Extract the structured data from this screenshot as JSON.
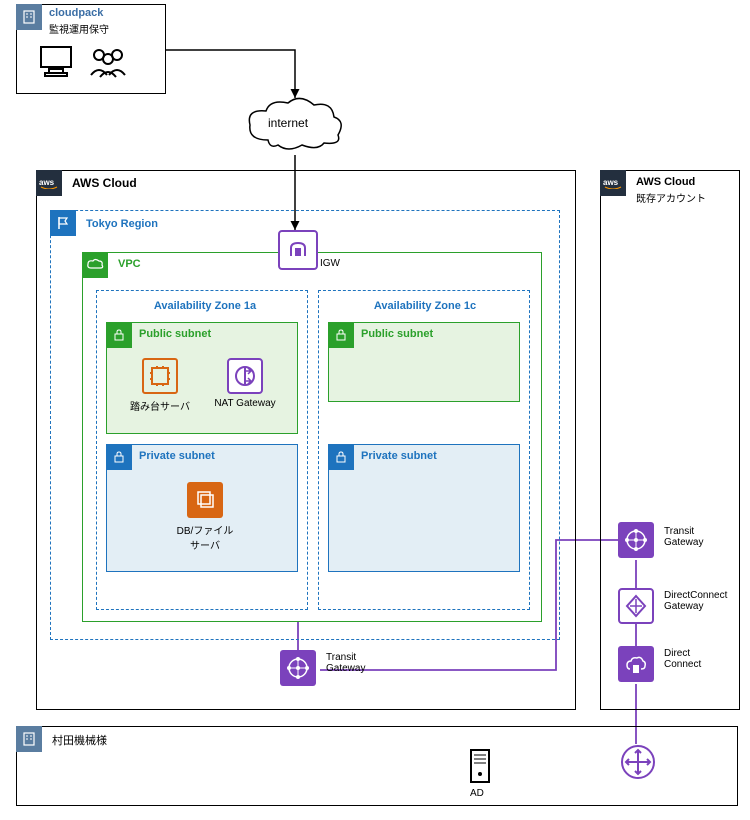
{
  "cloudpack": {
    "title": "cloudpack",
    "sub": "監視運用保守"
  },
  "internet": {
    "label": "internet"
  },
  "aws_main": {
    "title": "AWS Cloud"
  },
  "region": {
    "title": "Tokyo Region"
  },
  "vpc": {
    "title": "VPC"
  },
  "igw": {
    "label": "IGW"
  },
  "az1a": {
    "title": "Availability Zone 1a"
  },
  "az1c": {
    "title": "Availability Zone 1c"
  },
  "public_subnet": {
    "title": "Public subnet"
  },
  "private_subnet": {
    "title": "Private subnet"
  },
  "bastion": {
    "label": "踏み台サーバ"
  },
  "natgw": {
    "label": "NAT Gateway"
  },
  "dbfile": {
    "label1": "DB/ファイル",
    "label2": "サーバ"
  },
  "tgw1": {
    "label1": "Transit",
    "label2": "Gateway"
  },
  "aws_right": {
    "title": "AWS Cloud",
    "sub": "既存アカウント"
  },
  "tgw2": {
    "label1": "Transit",
    "label2": "Gateway"
  },
  "dcgw": {
    "label1": "DirectConnect",
    "label2": "Gateway"
  },
  "dc": {
    "label1": "Direct",
    "label2": "Connect"
  },
  "customer": {
    "title": "村田機械様"
  },
  "ad": {
    "label": "AD"
  }
}
